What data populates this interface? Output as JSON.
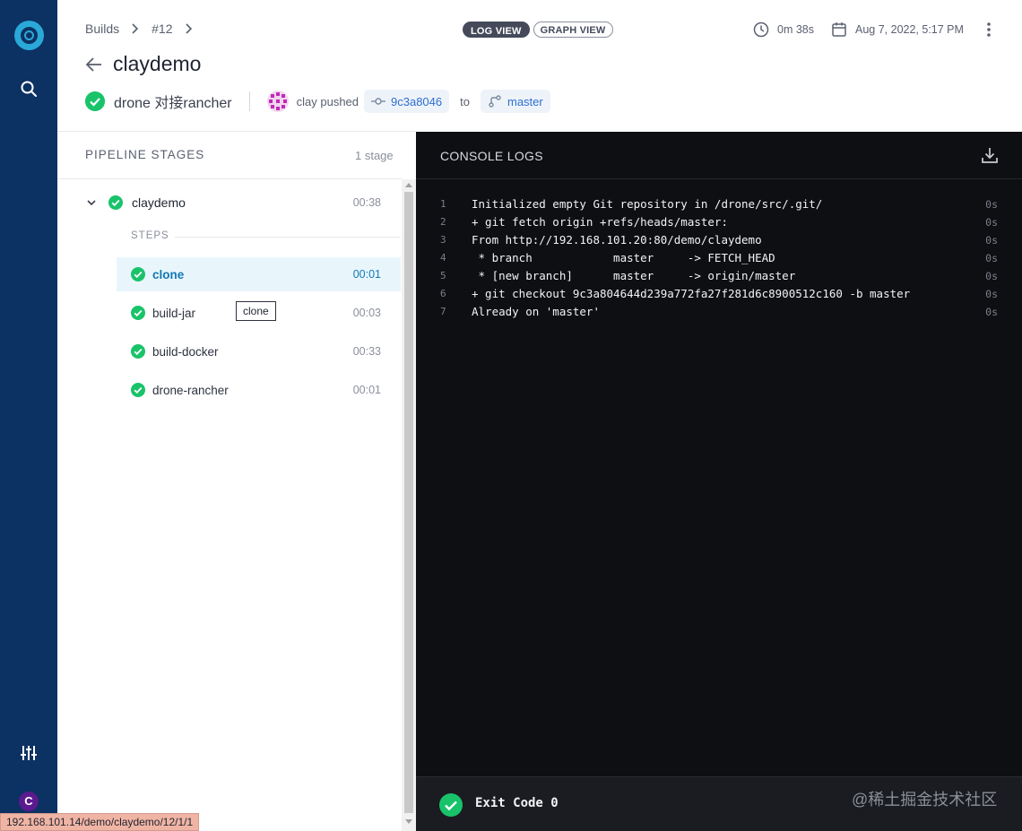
{
  "nav": {
    "avatar_initial": "C"
  },
  "header": {
    "breadcrumb": [
      "Builds",
      "#12"
    ],
    "view_toggle": {
      "active": "LOG VIEW",
      "inactive": "GRAPH VIEW"
    },
    "duration": "0m 38s",
    "date": "Aug 7, 2022, 5:17 PM",
    "repo_title": "claydemo",
    "commit_message": "drone 对接rancher",
    "author_action": "clay pushed",
    "commit_sha": "9c3a8046",
    "to_label": "to",
    "branch": "master"
  },
  "pipeline": {
    "header": "PIPELINE STAGES",
    "count": "1 stage",
    "stage": {
      "name": "claydemo",
      "time": "00:38"
    },
    "steps_label": "STEPS",
    "steps": [
      {
        "name": "clone",
        "time": "00:01",
        "active": true
      },
      {
        "name": "build-jar",
        "time": "00:03",
        "active": false
      },
      {
        "name": "build-docker",
        "time": "00:33",
        "active": false
      },
      {
        "name": "drone-rancher",
        "time": "00:01",
        "active": false
      }
    ],
    "tooltip": "clone"
  },
  "console": {
    "title": "CONSOLE LOGS",
    "lines": [
      {
        "num": "1",
        "text": "Initialized empty Git repository in /drone/src/.git/",
        "time": "0s"
      },
      {
        "num": "2",
        "text": "+ git fetch origin +refs/heads/master:",
        "time": "0s"
      },
      {
        "num": "3",
        "text": "From http://192.168.101.20:80/demo/claydemo",
        "time": "0s"
      },
      {
        "num": "4",
        "text": " * branch            master     -> FETCH_HEAD",
        "time": "0s"
      },
      {
        "num": "5",
        "text": " * [new branch]      master     -> origin/master",
        "time": "0s"
      },
      {
        "num": "6",
        "text": "+ git checkout 9c3a804644d239a772fa27f281d6c8900512c160 -b master",
        "time": "0s"
      },
      {
        "num": "7",
        "text": "Already on 'master'",
        "time": "0s"
      }
    ],
    "exit": "Exit Code 0",
    "watermark": "@稀土掘金技术社区"
  },
  "status_url": "192.168.101.14/demo/claydemo/12/1/1",
  "colors": {
    "sidebar": "#0c3163",
    "success": "#19c36a",
    "accent": "#1577b5",
    "console_bg": "#0e0f12"
  }
}
